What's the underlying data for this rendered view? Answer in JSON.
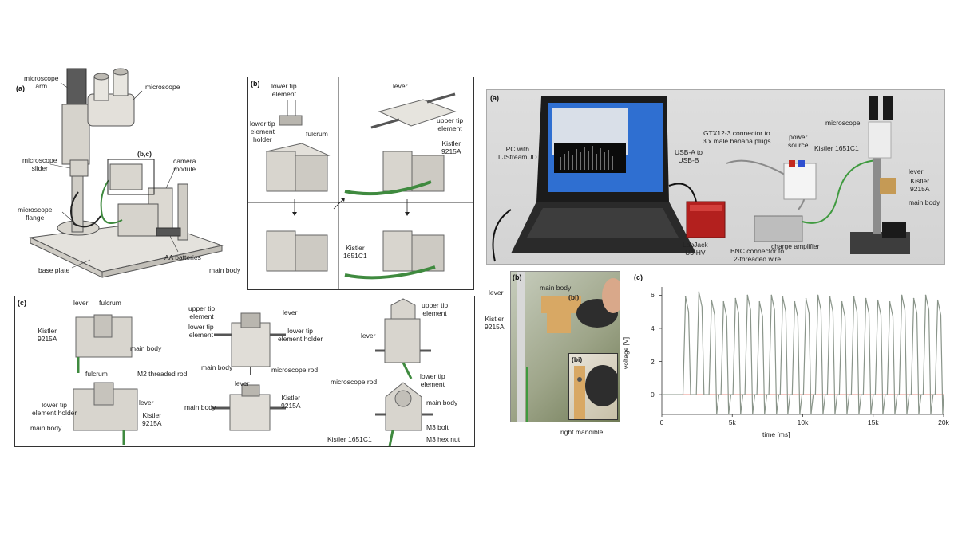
{
  "left_figure": {
    "panel_a": {
      "letter": "(a)",
      "labels": {
        "microscope_arm": "microscope\narm",
        "microscope": "microscope",
        "microscope_slider": "microscope\nslider",
        "bc_callout": "(b,c)",
        "camera_module": "camera\nmodule",
        "microscope_flange": "microscope\nflange",
        "aa_batteries": "AA batteries",
        "base_plate": "base plate"
      }
    },
    "panel_b": {
      "letter": "(b)",
      "labels": {
        "lower_tip_element": "lower tip\nelement",
        "lower_tip_element_holder": "lower tip\nelement\nholder",
        "fulcrum": "fulcrum",
        "lever": "lever",
        "upper_tip_element": "upper tip\nelement",
        "kistler_9215a": "Kistler\n9215A",
        "main_body": "main body",
        "kistler_1651c1": "Kistler\n1651C1"
      }
    },
    "panel_c": {
      "letter": "(c)",
      "labels": {
        "lever_1": "lever",
        "fulcrum_1": "fulcrum",
        "kistler_9215a_1": "Kistler\n9215A",
        "main_body_1": "main body",
        "fulcrum_2": "fulcrum",
        "m2_threaded_rod": "M2 threaded rod",
        "lever_2": "lever",
        "lower_tip_element_holder": "lower tip\nelement holder",
        "kistler_9215a_2": "Kistler\n9215A",
        "main_body_2": "main body",
        "upper_tip_element_1": "upper tip\nelement",
        "lever_3": "lever",
        "lower_tip_element_1": "lower tip\nelement",
        "lower_tip_element_holder_2": "lower tip\nelement holder",
        "main_body_3": "main body",
        "microscope_rod_1": "microscope rod",
        "lever_4": "lever",
        "main_body_4": "main body",
        "kistler_9215a_3": "Kistler\n9215A",
        "upper_tip_element_2": "upper tip\nelement",
        "lever_5": "lever",
        "microscope_rod_2": "microscope rod",
        "lower_tip_element_2": "lower tip\nelement",
        "main_body_5": "main body",
        "m3_bolt": "M3 bolt",
        "kistler_1651c1": "Kistler 1651C1",
        "m3_hex_nut": "M3 hex nut"
      }
    }
  },
  "right_figure": {
    "panel_a": {
      "letter": "(a)",
      "labels": {
        "pc": "PC with\nLJStreamUD",
        "usb": "USB-A to\nUSB-B",
        "gtx": "GTX12-3 connector to\n3 x male banana plugs",
        "power_source": "power\nsource",
        "kistler_1651c1": "Kistler 1651C1",
        "microscope": "microscope",
        "lever": "lever",
        "kistler_9215a": "Kistler\n9215A",
        "main_body": "main body",
        "labjack": "LabJack\nU3-HV",
        "bnc": "BNC connector to\n2-threaded wire",
        "charge_amplifier": "charge amplifier"
      }
    },
    "panel_b": {
      "letter": "(b)",
      "labels": {
        "lever": "lever",
        "main_body": "main body",
        "bi_callout": "(bi)",
        "kistler_9215a": "Kistler\n9215A",
        "bi_inset": "(bi)",
        "right_mandible": "right mandible"
      }
    },
    "panel_c": {
      "letter": "(c)"
    }
  },
  "chart_data": {
    "type": "line",
    "xlabel": "time [ms]",
    "ylabel": "voltage [V]",
    "xlim": [
      0,
      20000
    ],
    "ylim": [
      -1.2,
      6.5
    ],
    "x_ticks": [
      0,
      5000,
      10000,
      15000,
      20000
    ],
    "x_tick_labels": [
      "0",
      "5k",
      "10k",
      "15k",
      "20k"
    ],
    "y_ticks": [
      0,
      2,
      4,
      6
    ],
    "y_tick_labels": [
      "0",
      "2",
      "4",
      "6"
    ],
    "grid": false,
    "series": [
      {
        "color": "#8a958a",
        "pulses": [
          {
            "t": 1500,
            "peak": 5.9
          },
          {
            "t": 2450,
            "peak": 6.2
          },
          {
            "t": 3350,
            "peak": 5.7
          },
          {
            "t": 4200,
            "peak": 5.6
          },
          {
            "t": 5050,
            "peak": 5.8
          },
          {
            "t": 5900,
            "peak": 6.0
          },
          {
            "t": 6750,
            "peak": 5.6
          },
          {
            "t": 7600,
            "peak": 6.0
          },
          {
            "t": 8400,
            "peak": 5.9
          },
          {
            "t": 9250,
            "peak": 5.6
          },
          {
            "t": 10050,
            "peak": 5.8
          },
          {
            "t": 10900,
            "peak": 6.0
          },
          {
            "t": 11750,
            "peak": 5.9
          },
          {
            "t": 12600,
            "peak": 5.6
          },
          {
            "t": 13450,
            "peak": 5.9
          },
          {
            "t": 14300,
            "peak": 5.8
          },
          {
            "t": 15150,
            "peak": 5.7
          },
          {
            "t": 16000,
            "peak": 5.6
          },
          {
            "t": 16850,
            "peak": 6.0
          },
          {
            "t": 17700,
            "peak": 5.8
          },
          {
            "t": 18550,
            "peak": 6.0
          },
          {
            "t": 19400,
            "peak": 5.7
          }
        ],
        "baseline": 0.0,
        "trough": -1.6
      },
      {
        "color": "#e46b5f",
        "constant": 0.0
      }
    ]
  }
}
